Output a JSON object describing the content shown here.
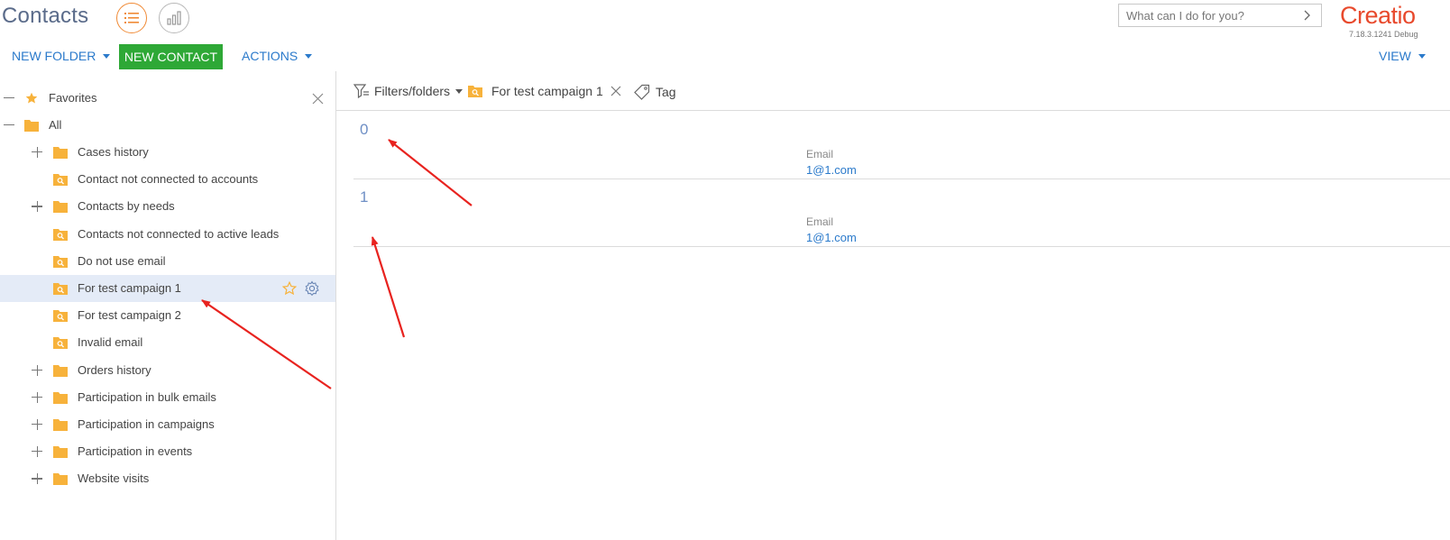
{
  "header": {
    "title": "Contacts",
    "search_placeholder": "What can I do for you?",
    "logo_text": "Creatio",
    "version": "7.18.3.1241 Debug"
  },
  "toolbar": {
    "new_folder": "NEW FOLDER",
    "new_contact": "NEW CONTACT",
    "actions": "ACTIONS",
    "view": "VIEW"
  },
  "sidebar": {
    "favorites": "Favorites",
    "all": "All",
    "folders": [
      {
        "label": "Cases history",
        "type": "folder",
        "expandable": true
      },
      {
        "label": "Contact not connected to accounts",
        "type": "dynamic",
        "expandable": false
      },
      {
        "label": "Contacts by needs",
        "type": "folder",
        "expandable": true
      },
      {
        "label": "Contacts not connected to active leads",
        "type": "dynamic",
        "expandable": false
      },
      {
        "label": "Do not use email",
        "type": "dynamic",
        "expandable": false
      },
      {
        "label": "For test campaign 1",
        "type": "dynamic",
        "expandable": false,
        "selected": true
      },
      {
        "label": "For test campaign 2",
        "type": "dynamic",
        "expandable": false
      },
      {
        "label": "Invalid email",
        "type": "dynamic",
        "expandable": false
      },
      {
        "label": "Orders history",
        "type": "folder",
        "expandable": true
      },
      {
        "label": "Participation in bulk emails",
        "type": "folder",
        "expandable": true
      },
      {
        "label": "Participation in campaigns",
        "type": "folder",
        "expandable": true
      },
      {
        "label": "Participation in events",
        "type": "folder",
        "expandable": true
      },
      {
        "label": "Website visits",
        "type": "folder",
        "expandable": true
      }
    ]
  },
  "filters": {
    "filters_folders": "Filters/folders",
    "active_folder": "For test campaign 1",
    "tag": "Tag"
  },
  "records": [
    {
      "name": "0",
      "field_caption": "Email",
      "field_value": "1@1.com"
    },
    {
      "name": "1",
      "field_caption": "Email",
      "field_value": "1@1.com"
    }
  ],
  "colors": {
    "accent_orange": "#f08a35",
    "primary_green": "#2ea836",
    "link_blue": "#2b7acb",
    "folder_yellow": "#f7b23b",
    "annotation_red": "#e8231f",
    "selected_row": "#e4ebf7"
  }
}
